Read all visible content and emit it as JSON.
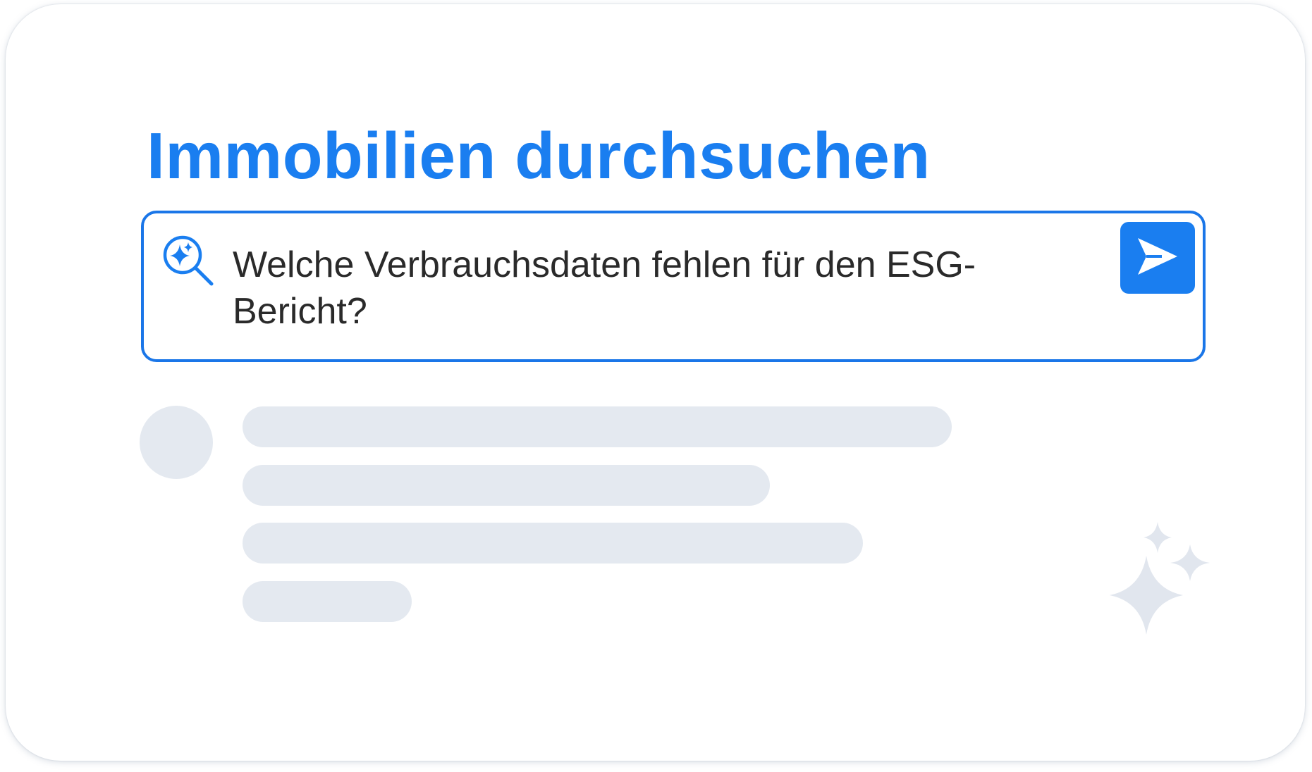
{
  "header": {
    "title": "Immobilien durchsuchen"
  },
  "search": {
    "query": "Welche Verbrauchsdaten fehlen für den ESG-Bericht?",
    "icon": "ai-search-icon",
    "send_icon": "send-icon"
  },
  "skeleton": {
    "avatar": "avatar-placeholder",
    "lines": 4
  },
  "decoration": {
    "icon": "sparkles-icon"
  },
  "colors": {
    "accent": "#1a7ef0",
    "border": "#1a76e8",
    "skeleton": "#e4e9f0",
    "sparkle": "#e1e6ee",
    "text": "#2a2a2a"
  }
}
